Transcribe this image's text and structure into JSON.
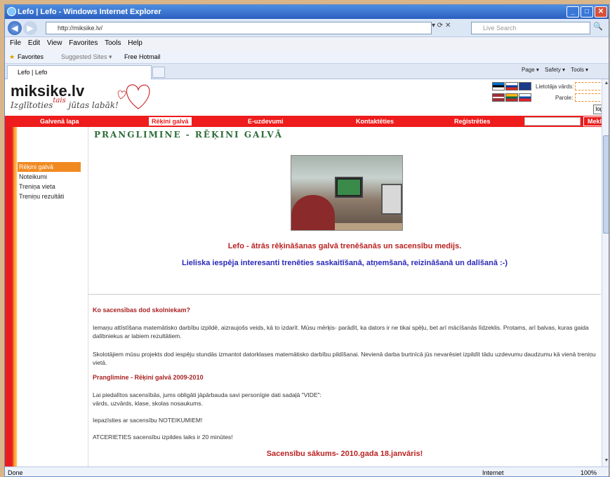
{
  "window": {
    "title": "Lefo | Lefo - Windows Internet Explorer"
  },
  "address": {
    "url": "http://miksike.lv/",
    "search_placeholder": "Live Search"
  },
  "menu": [
    "File",
    "Edit",
    "View",
    "Favorites",
    "Tools",
    "Help"
  ],
  "favbar": {
    "favorites": "Favorites",
    "suggested": "Suggested Sites ▾",
    "hotmail": "Free Hotmail"
  },
  "tab": {
    "label": "Lefo | Lefo"
  },
  "commands": [
    "Page ▾",
    "Safety ▾",
    "Tools ▾"
  ],
  "site": {
    "logo": "miksike.lv",
    "slogan_a": "Izglītoties",
    "slogan_tais": "tais",
    "slogan_b": "jūtas labāk!",
    "login_user_label": "Lietotāja vārds:",
    "login_pass_label": "Parole:",
    "login_button": "login"
  },
  "nav": {
    "items": [
      "Galvenā lapa",
      "Rēķini galvā",
      "E-uzdevumi",
      "Kontaktēties",
      "Reģistrēties"
    ],
    "search_button": "Meklēt"
  },
  "sidebar": [
    "Rēķini galvā",
    "Noteikumi",
    "Treniņa vieta",
    "Treniņu rezultāti"
  ],
  "content": {
    "heading": "PRANGLIMINE - RĒĶINI GALVĀ",
    "lead1": "Lefo - ātrās rēķināšanas galvā trenēšanās un sacensību medijs.",
    "lead2": "Lieliska iespēja interesanti trenēties saskaitīšanā, atņemšanā, reizināšanā un dalīšanā :-)",
    "q1": "Ko sacensības dod skolniekam?",
    "p1": "Iemaņu attīstīšana matemātisko darbību izpildē, aizraujošs veids, kā to izdarīt. Mūsu mērķis- parādīt, ka dators ir ne tikai spēļu, bet arī  mācīšanās līdzeklis. Protams, arī balvas, kuras gaida dalībniekus ar labiem rezultātiem.",
    "p2": "Skolotājiem mūsu projekts dod iespēju stundās izmantot datorklases matemātisko darbību pildīšanai. Nevienā darba burtnīcā jūs nevarēsiet izpildīt tādu uzdevumu daudzumu kā vienā treniņu vietā.",
    "h2": "Pranglimine - Rēķini galvā 2009-2010",
    "p3a": "Lai piedalītos sacensībās, jums obligāti jāpārbauda savi personīgie dati sadaļā \"VIDE\":",
    "p3b": "vārds, uzvārds, klase, skolas nosaukums.",
    "p4": "Iepazīsties ar sacensību NOTEIKUMIEM!",
    "p5": "ATCERIETIES sacensību izpildes laiks ir 20 minūtes!",
    "start": "Sacensību sākums- 2010.gada 18.janvāris!"
  },
  "status": {
    "left": "Done",
    "zone": "Internet",
    "zoom": "100%"
  },
  "colors": {
    "nav_red": "#ee1c1c",
    "sidebar_orange": "#f08a20",
    "heading_green": "#2e6d3a"
  }
}
